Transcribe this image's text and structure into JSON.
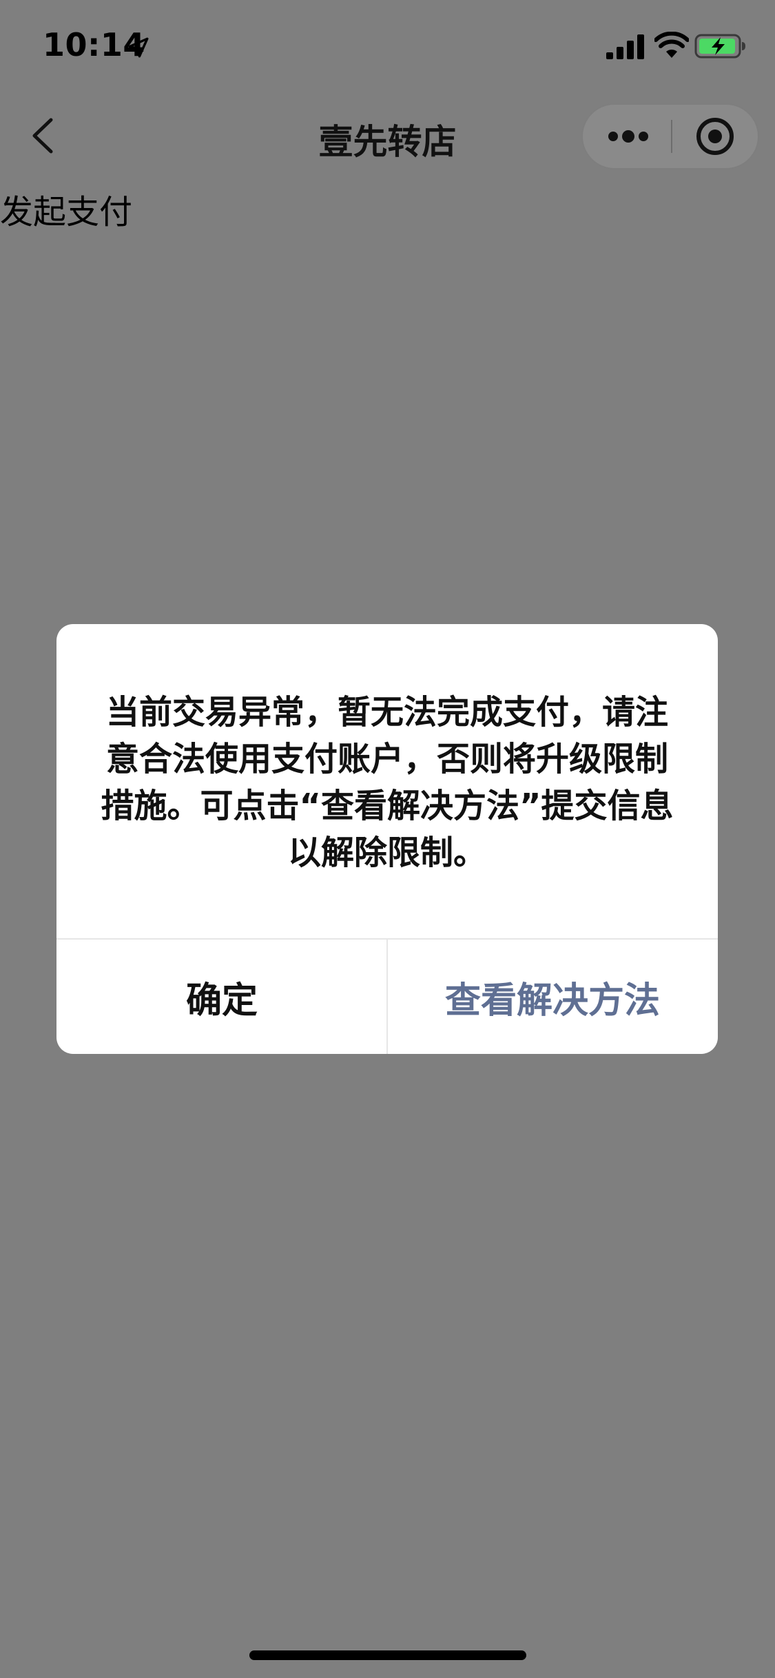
{
  "status_bar": {
    "time": "10:14",
    "icons": [
      "location-arrow-icon",
      "signal-icon",
      "wifi-icon",
      "battery-charging-icon"
    ],
    "battery_color": "#4cd964"
  },
  "nav": {
    "title": "壹先转店",
    "icons": [
      "chevron-left-icon",
      "more-dots-icon",
      "target-close-icon"
    ]
  },
  "page": {
    "text": "发起支付"
  },
  "dialog": {
    "message": "当前交易异常，暂无法完成支付，请注意合法使用支付账户，否则将升级限制措施。可点击“查看解决方法”提交信息以解除限制。",
    "confirm_label": "确定",
    "solution_label": "查看解决方法",
    "solution_color": "#5f6f93"
  },
  "colors": {
    "overlay": "#7f7f7f",
    "dialog_bg": "#ffffff"
  }
}
